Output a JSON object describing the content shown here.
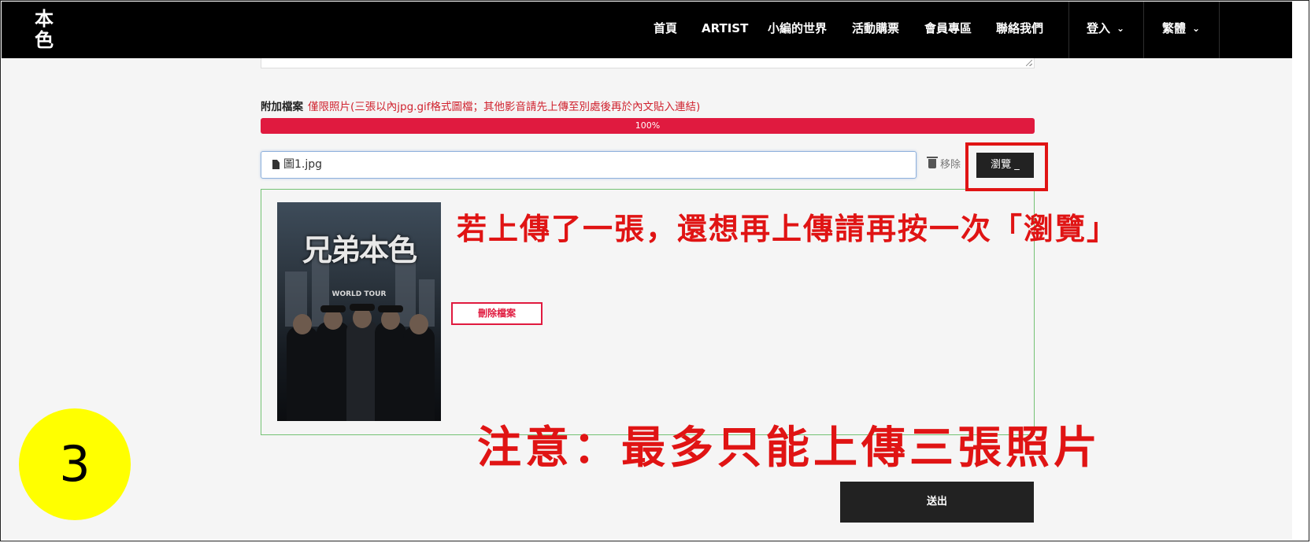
{
  "nav": {
    "logo_text": "本色",
    "items": [
      "首頁",
      "ARTIST",
      "小編的世界",
      "活動購票",
      "會員專區",
      "聯絡我們"
    ],
    "login": "登入",
    "language": "繁體"
  },
  "attachment": {
    "label": "附加檔案",
    "note": "僅限照片(三張以內jpg.gif格式圖檔；其他影音請先上傳至別處後再於內文貼入連結)",
    "progress_text": "100%",
    "progress_value": 1.0,
    "file_name": "圖1.jpg",
    "remove_label": "移除",
    "browse_label": "瀏覽 _",
    "delete_file_label": "刪除檔案"
  },
  "poster": {
    "title": "兄弟本色",
    "subtitle": "WORLD TOUR"
  },
  "submit_label": "送出",
  "annotations": {
    "step_number": "3",
    "upload_tip": "若上傳了一張，還想再上傳請再按一次「瀏覽」",
    "limit_note": "注意：最多只能上傳三張照片"
  },
  "colors": {
    "accent_red": "#e01a3f",
    "annotation_red": "#e01414",
    "nav_background": "#000000",
    "step_circle": "#ffff00"
  }
}
